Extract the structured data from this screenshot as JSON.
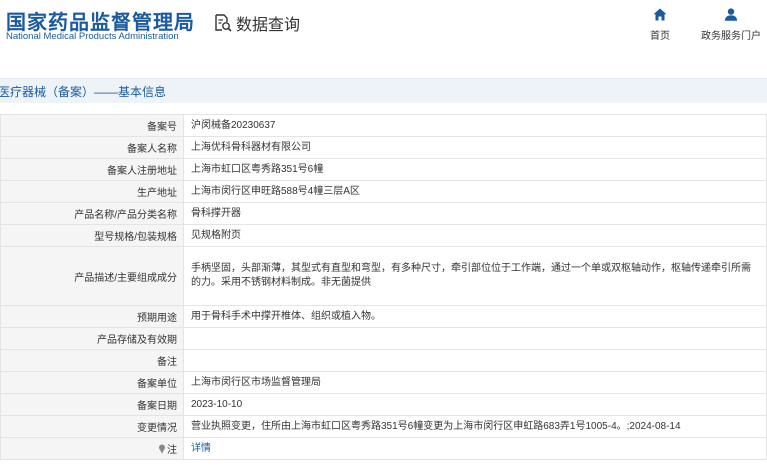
{
  "header": {
    "logo_cn": "国家药品监督管理局",
    "logo_en": "National Medical Products Administration",
    "data_query": "数据查询",
    "nav": {
      "home": "首页",
      "portal": "政务服务门户"
    }
  },
  "section": {
    "title": "医疗器械（备案）——基本信息"
  },
  "rows": [
    {
      "label": "备案号",
      "value": "沪闵械备20230637"
    },
    {
      "label": "备案人名称",
      "value": "上海优科骨科器材有限公司"
    },
    {
      "label": "备案人注册地址",
      "value": "上海市虹口区粤秀路351号6幢"
    },
    {
      "label": "生产地址",
      "value": "上海市闵行区申旺路588号4幢三层A区"
    },
    {
      "label": "产品名称/产品分类名称",
      "value": "骨科撑开器"
    },
    {
      "label": "型号规格/包装规格",
      "value": "见规格附页"
    },
    {
      "label": "产品描述/主要组成成分",
      "value": "手柄坚固，头部渐薄，其型式有直型和弯型，有多种尺寸，牵引部位位于工作端，通过一个单或双枢轴动作，枢轴传递牵引所需的力。采用不锈钢材料制成。非无菌提供"
    },
    {
      "label": "预期用途",
      "value": "用于骨科手术中撑开椎体、组织或植入物。"
    },
    {
      "label": "产品存储及有效期",
      "value": ""
    },
    {
      "label": "备注",
      "value": ""
    },
    {
      "label": "备案单位",
      "value": "上海市闵行区市场监督管理局"
    },
    {
      "label": "备案日期",
      "value": "2023-10-10"
    },
    {
      "label": "变更情况",
      "value": "营业执照变更，住所由上海市虹口区粤秀路351号6幢变更为上海市闵行区申虹路683弄1号1005-4。;2024-08-14"
    },
    {
      "label": "注",
      "value": "详情"
    }
  ],
  "colors": {
    "brand_blue": "#1a5a9e",
    "label_bg": "#f5f5f5",
    "section_bg": "#eef3f8"
  },
  "icons": {
    "data_query": "search-document-icon",
    "home": "home-icon",
    "portal": "user-icon",
    "note": "pin-icon"
  }
}
